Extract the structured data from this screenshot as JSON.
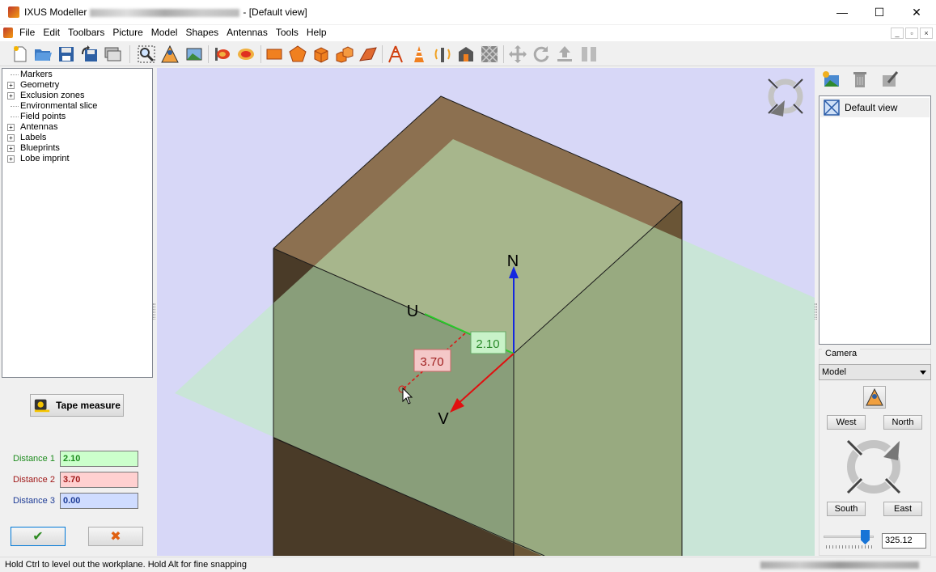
{
  "window": {
    "title_prefix": "IXUS Modeller",
    "title_suffix": "- [Default view]",
    "minimize": "—",
    "maximize": "☐",
    "close": "✕"
  },
  "menu": [
    "File",
    "Edit",
    "Toolbars",
    "Picture",
    "Model",
    "Shapes",
    "Antennas",
    "Tools",
    "Help"
  ],
  "tree": [
    {
      "label": "Markers",
      "expandable": false
    },
    {
      "label": "Geometry",
      "expandable": true
    },
    {
      "label": "Exclusion zones",
      "expandable": true
    },
    {
      "label": "Environmental slice",
      "expandable": false
    },
    {
      "label": "Field points",
      "expandable": false
    },
    {
      "label": "Antennas",
      "expandable": true
    },
    {
      "label": "Labels",
      "expandable": true
    },
    {
      "label": "Blueprints",
      "expandable": true
    },
    {
      "label": "Lobe imprint",
      "expandable": true
    }
  ],
  "tape_measure": {
    "label": "Tape measure"
  },
  "distances": [
    {
      "label": "Distance 1",
      "value": "2.10",
      "color": "#1e8c1e",
      "bg": "#ccffcc"
    },
    {
      "label": "Distance 2",
      "value": "3.70",
      "color": "#a01818",
      "bg": "#ffd0d0"
    },
    {
      "label": "Distance 3",
      "value": "0.00",
      "color": "#1e3c96",
      "bg": "#cfdcff"
    }
  ],
  "ok_glyph": "✔",
  "cancel_glyph": "✖",
  "viewport": {
    "axis_n": "N",
    "axis_u": "U",
    "axis_v": "V",
    "measure_u": "2.10",
    "measure_v": "3.70"
  },
  "views": [
    {
      "label": "Default view"
    }
  ],
  "camera": {
    "title": "Camera",
    "mode": "Model",
    "west": "West",
    "north": "North",
    "south": "South",
    "east": "East",
    "zoom": "325.12",
    "zoom_fraction": 0.85
  },
  "status": "Hold Ctrl to level out the workplane. Hold Alt for fine snapping"
}
